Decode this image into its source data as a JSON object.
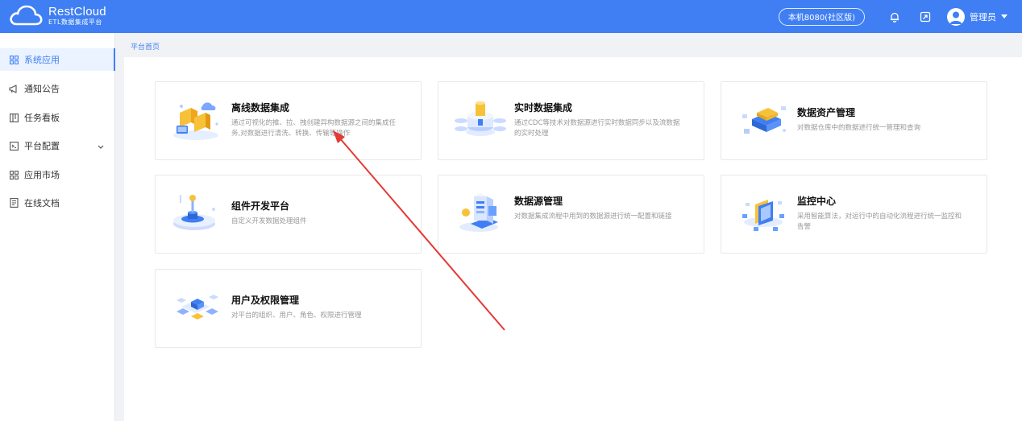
{
  "header": {
    "brand": "RestCloud",
    "subtitle": "ETL数据集成平台",
    "env": "本机8080(社区版)",
    "user": "管理员"
  },
  "sidebar": {
    "items": [
      {
        "label": "系统应用",
        "icon": "grid-icon",
        "active": true
      },
      {
        "label": "通知公告",
        "icon": "megaphone-icon"
      },
      {
        "label": "任务看板",
        "icon": "board-icon"
      },
      {
        "label": "平台配置",
        "icon": "config-icon",
        "has_children": true
      },
      {
        "label": "应用市场",
        "icon": "apps-icon"
      },
      {
        "label": "在线文档",
        "icon": "document-icon"
      }
    ]
  },
  "breadcrumb": "平台首页",
  "cards": [
    {
      "title": "离线数据集成",
      "desc": "通过可视化的推、拉、拽创建异构数据源之间的集成任务,对数据进行清洗、转换、传输等操作"
    },
    {
      "title": "实时数据集成",
      "desc": "通过CDC等技术对数据源进行实时数据同步以及流数据的实时处理"
    },
    {
      "title": "数据资产管理",
      "desc": "对数据仓库中的数据进行统一管理和查询"
    },
    {
      "title": "组件开发平台",
      "desc": "自定义开发数据处理组件"
    },
    {
      "title": "数据源管理",
      "desc": "对数据集成流程中用到的数据源进行统一配置和链接"
    },
    {
      "title": "监控中心",
      "desc": "采用智能算法，对运行中的自动化流程进行统一监控和告警"
    },
    {
      "title": "用户及权限管理",
      "desc": "对平台的组织、用户、角色、权限进行管理"
    }
  ],
  "colors": {
    "accent": "#3f7ff3",
    "annotation_arrow": "#e53935"
  }
}
